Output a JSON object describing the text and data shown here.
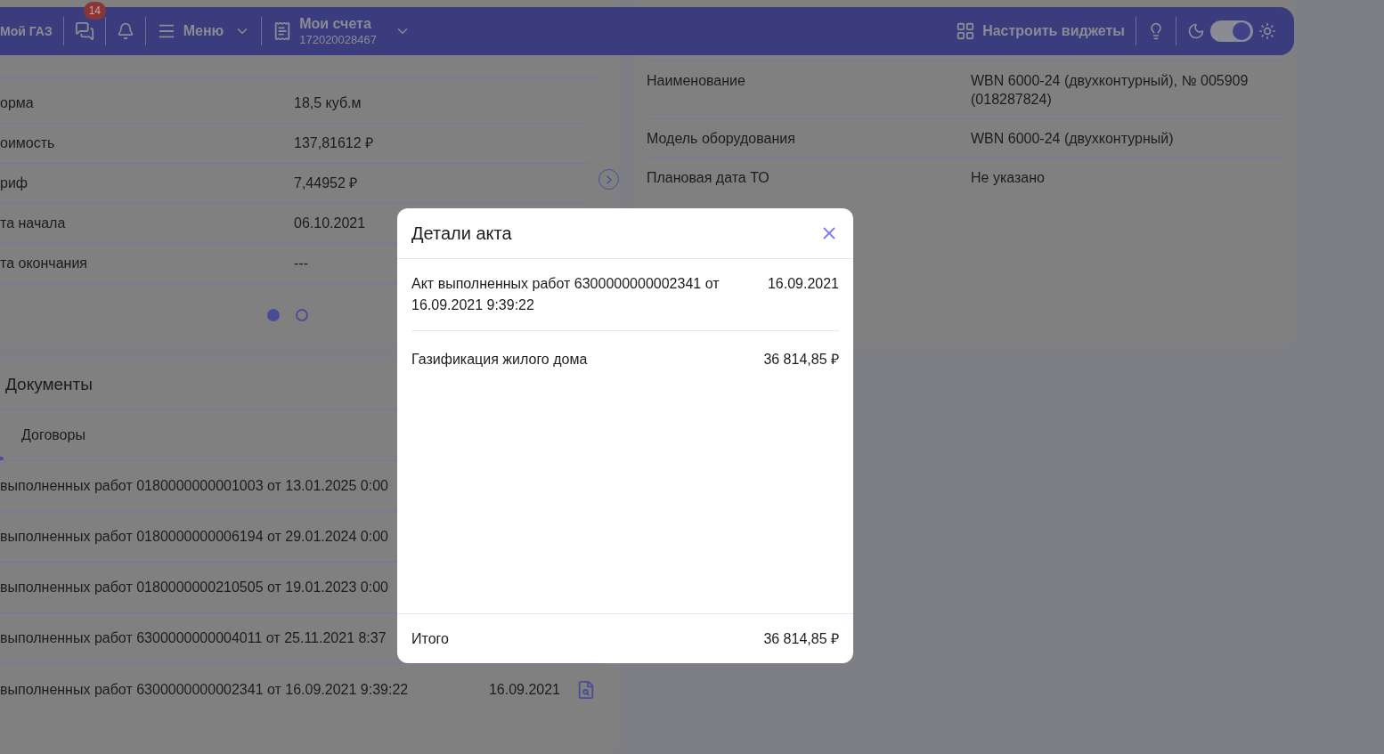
{
  "header": {
    "brand": "Мой ГАЗ",
    "chat_badge": "14",
    "menu_label": "Меню",
    "accounts": {
      "title": "Мои счета",
      "number": "172020028467"
    },
    "widgets_button": "Настроить виджеты",
    "theme_toggle": {
      "on": true
    }
  },
  "tariff_card": {
    "rows": [
      {
        "label": "орма",
        "value": "18,5 куб.м"
      },
      {
        "label": "оимость",
        "value": "137,81612 ₽"
      },
      {
        "label": "риф",
        "value": "7,44952 ₽"
      },
      {
        "label": "та начала",
        "value": "06.10.2021"
      },
      {
        "label": "та окончания",
        "value": "---"
      }
    ],
    "pages": [
      {
        "selected": true
      },
      {
        "selected": false
      }
    ]
  },
  "equipment_card": {
    "rows": [
      {
        "label": "Наименование",
        "value": "WBN 6000-24 (двухконтурный), № 005909 (018287824)"
      },
      {
        "label": "Модель оборудования",
        "value": "WBN 6000-24 (двухконтурный)"
      },
      {
        "label": "Плановая дата ТО",
        "value": "Не указано"
      }
    ]
  },
  "documents": {
    "title": "Документы",
    "tabs": [
      {
        "selected": true
      },
      {
        "label": "Договоры",
        "selected": false
      }
    ],
    "rows": [
      {
        "title": "выполненных работ 0180000000001003 от 13.01.2025 0:00"
      },
      {
        "title": "выполненных работ 0180000000006194 от 29.01.2024 0:00"
      },
      {
        "title": "выполненных работ 0180000000210505 от 19.01.2023 0:00"
      },
      {
        "title": "выполненных работ 6300000000004011 от 25.11.2021 8:37"
      },
      {
        "title": "выполненных работ 6300000000002341 от 16.09.2021 9:39:22",
        "date": "16.09.2021"
      }
    ]
  },
  "modal": {
    "title": "Детали акта",
    "act": {
      "text": "Акт выполненных работ 6300000000002341 от 16.09.2021 9:39:22",
      "date": "16.09.2021"
    },
    "items": [
      {
        "name": "Газификация жилого дома",
        "amount": "36 814,85 ₽"
      }
    ],
    "total": {
      "label": "Итого",
      "amount": "36 814,85 ₽"
    }
  }
}
